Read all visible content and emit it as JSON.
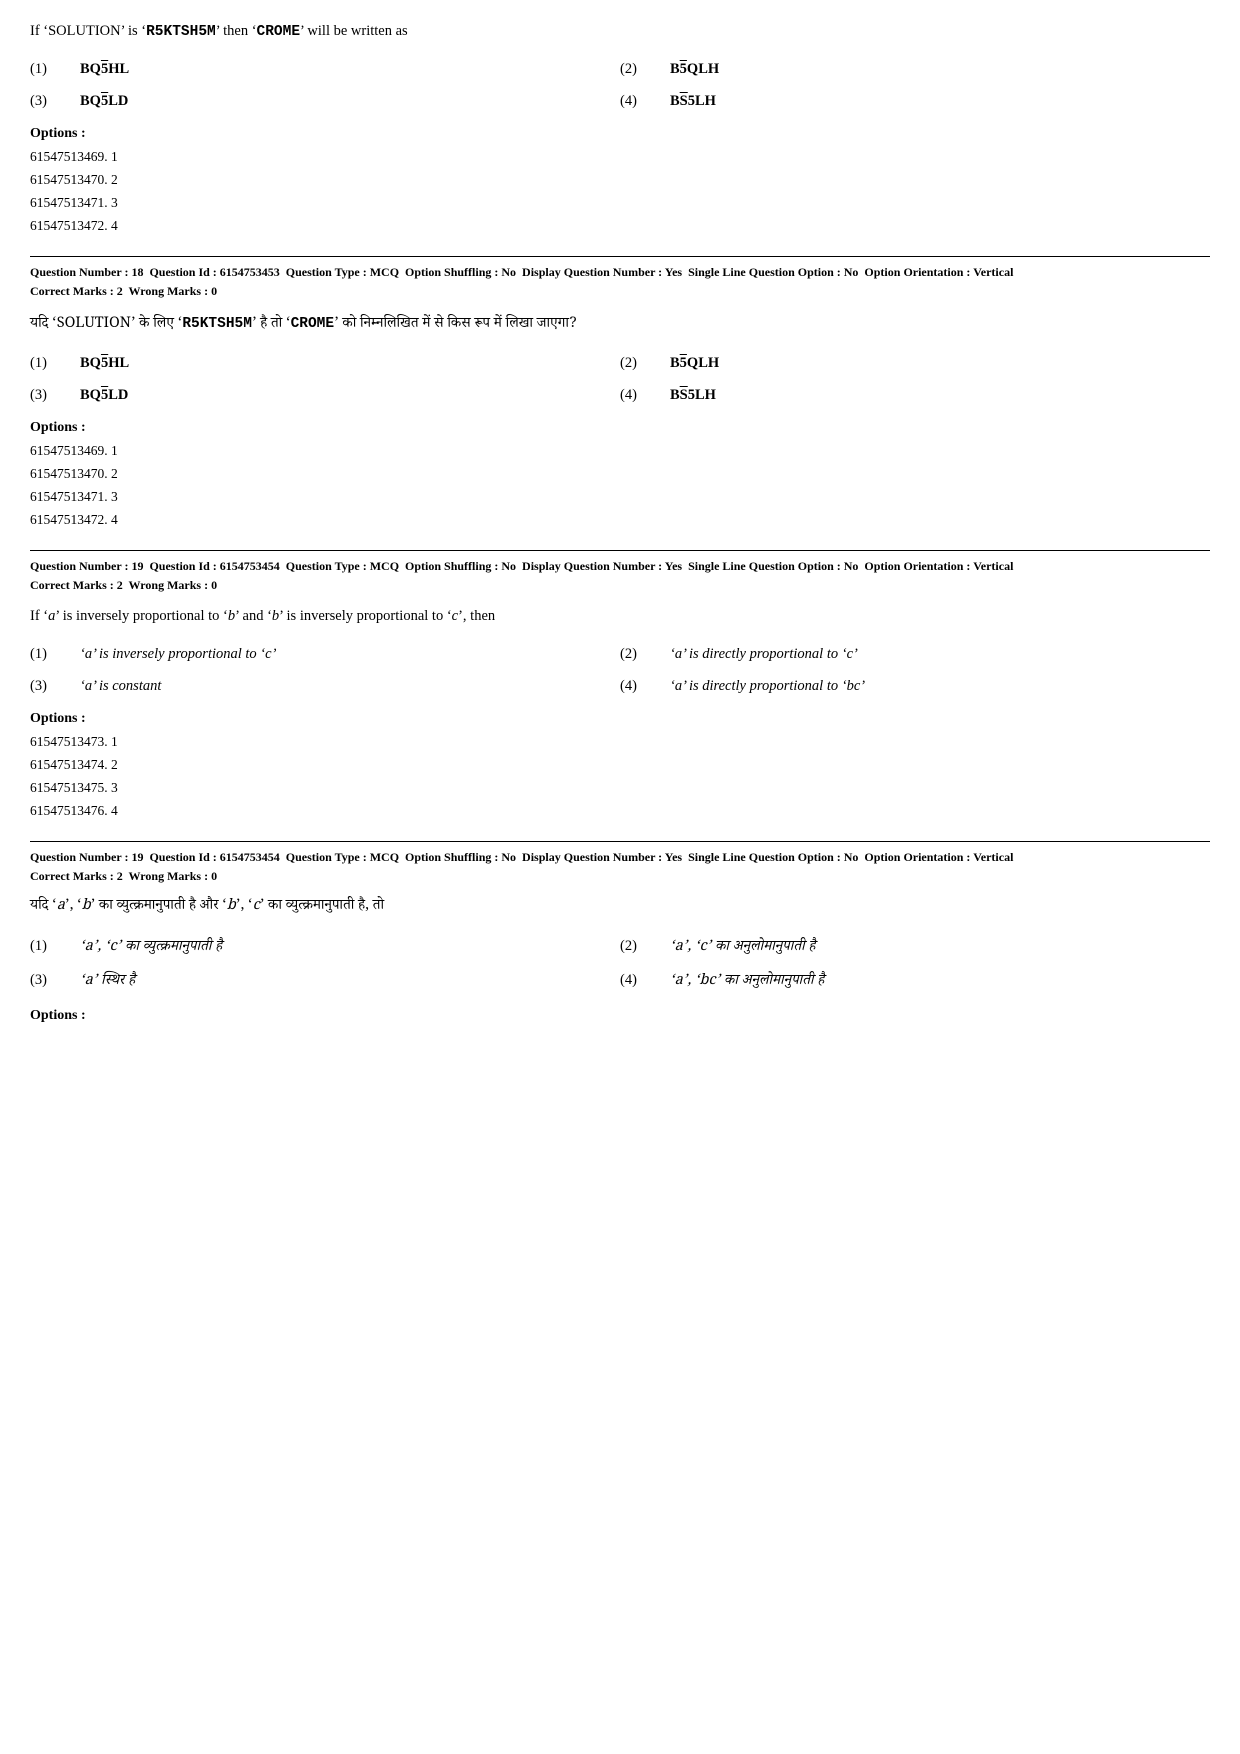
{
  "blocks": [
    {
      "id": "q17_en",
      "question_text": "If ‘SOLUTION’ is ‘R5KTSH5M’ then ‘CROME’ will be written as",
      "options": [
        {
          "num": "(1)",
          "val": "BQ5HL",
          "italic": false
        },
        {
          "num": "(2)",
          "val": "B5QLH",
          "italic": false
        },
        {
          "num": "(3)",
          "val": "BQ5LD",
          "italic": false
        },
        {
          "num": "(4)",
          "val": "BS5LH",
          "italic": false
        }
      ],
      "options_label": "Options :",
      "options_list": [
        "61547513469. 1",
        "61547513470. 2",
        "61547513471. 3",
        "61547513472. 4"
      ]
    },
    {
      "id": "q18_meta",
      "meta": "Question Number : 18  Question Id : 6154753453  Question Type : MCQ  Option Shuffling : No  Display Question Number : Yes  Single Line Question Option : No  Option Orientation : Vertical",
      "marks": "Correct Marks : 2  Wrong Marks : 0"
    },
    {
      "id": "q18_en",
      "question_text": "If ‘SOLUTION’ is ‘R5KTSH5M’ then ‘CROME’ will be written as",
      "options": [
        {
          "num": "(1)",
          "val": "BQ5HL",
          "italic": false
        },
        {
          "num": "(2)",
          "val": "B5QLH",
          "italic": false
        },
        {
          "num": "(3)",
          "val": "BQ5LD",
          "italic": false
        },
        {
          "num": "(4)",
          "val": "BS5LH",
          "italic": false
        }
      ],
      "options_label": "Options :",
      "options_list": [
        "61547513469. 1",
        "61547513470. 2",
        "61547513471. 3",
        "61547513472. 4"
      ]
    },
    {
      "id": "q19_meta",
      "meta": "Question Number : 19  Question Id : 6154753454  Question Type : MCQ  Option Shuffling : No  Display Question Number : Yes  Single Line Question Option : No  Option Orientation : Vertical",
      "marks": "Correct Marks : 2  Wrong Marks : 0"
    },
    {
      "id": "q19_en",
      "question_text": "If ‘a’ is inversely proportional to ‘b’ and ‘b’ is inversely proportional to ‘c’, then",
      "options": [
        {
          "num": "(1)",
          "val": "‘a’ is inversely proportional to ‘c’",
          "italic": true
        },
        {
          "num": "(2)",
          "val": "‘a’ is directly proportional to ‘c’",
          "italic": true
        },
        {
          "num": "(3)",
          "val": "‘a’ is constant",
          "italic": true
        },
        {
          "num": "(4)",
          "val": "‘a’ is directly proportional to ‘bc’",
          "italic": true
        }
      ],
      "options_label": "Options :",
      "options_list": [
        "61547513473. 1",
        "61547513474. 2",
        "61547513475. 3",
        "61547513476. 4"
      ]
    },
    {
      "id": "q19_meta2",
      "meta": "Question Number : 19  Question Id : 6154753454  Question Type : MCQ  Option Shuffling : No  Display Question Number : Yes  Single Line Question Option : No  Option Orientation : Vertical",
      "marks": "Correct Marks : 2  Wrong Marks : 0"
    },
    {
      "id": "q19_hi",
      "question_text_hindi": "यदि ‘a’, ‘b’ का व्युत्क्रमानुपाती है और ‘b’, ‘c’ का व्युत्क्रमानुपाती है, तो",
      "options_hindi": [
        {
          "num": "(1)",
          "val": "‘a’, ‘c’ का व्युत्क्रमानुपाती है"
        },
        {
          "num": "(2)",
          "val": "‘a’, ‘c’ का अनुलोमानुपाती है"
        },
        {
          "num": "(3)",
          "val": "‘a’ स्थिर है"
        },
        {
          "num": "(4)",
          "val": "‘a’, ‘bc’ का अनुलोमानुपाती है"
        }
      ],
      "options_label": "Options :"
    }
  ]
}
